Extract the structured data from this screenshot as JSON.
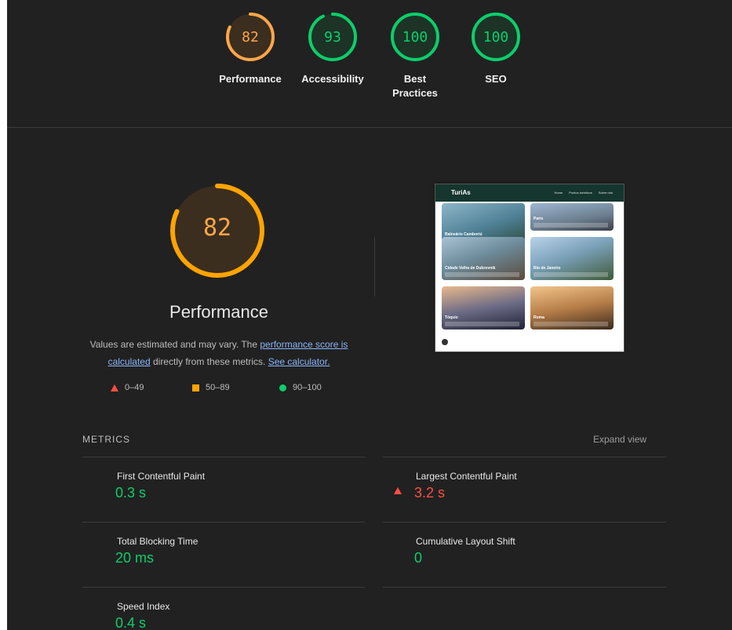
{
  "summary": [
    {
      "score": "82",
      "label": "Performance",
      "color": "#ffa64a",
      "fraction": 0.82
    },
    {
      "score": "93",
      "label": "Accessibility",
      "color": "#0cce6b",
      "fraction": 0.93
    },
    {
      "score": "100",
      "label": "Best Practices",
      "color": "#0cce6b",
      "fraction": 1.0
    },
    {
      "score": "100",
      "label": "SEO",
      "color": "#0cce6b",
      "fraction": 1.0
    }
  ],
  "performance": {
    "score": "82",
    "fraction": 0.82,
    "title": "Performance",
    "desc_prefix": "Values are estimated and may vary. The ",
    "desc_link1": "performance score is calculated",
    "desc_mid": " directly from these metrics. ",
    "desc_link2": "See calculator."
  },
  "legend": {
    "fail": "0–49",
    "average": "50–89",
    "pass": "90–100"
  },
  "thumbnail": {
    "brand": "TuriAs",
    "nav": [
      "Home",
      "Pontos turísticos",
      "Sobre nós"
    ],
    "cards": [
      "Balneário Camboriú",
      "Paris",
      "Cidade Velha de Dubrovnik",
      "Rio de Janeiro",
      "Tóquio",
      "Roma"
    ]
  },
  "metrics": {
    "header": "METRICS",
    "expand_label": "Expand view",
    "items": [
      {
        "label": "First Contentful Paint",
        "value": "0.3 s",
        "status": "pass"
      },
      {
        "label": "Largest Contentful Paint",
        "value": "3.2 s",
        "status": "fail"
      },
      {
        "label": "Total Blocking Time",
        "value": "20 ms",
        "status": "pass"
      },
      {
        "label": "Cumulative Layout Shift",
        "value": "0",
        "status": "pass"
      },
      {
        "label": "Speed Index",
        "value": "0.4 s",
        "status": "pass"
      }
    ]
  },
  "colors": {
    "pass": "#0cce6b",
    "average": "#ffa400",
    "fail": "#ff4e42"
  }
}
